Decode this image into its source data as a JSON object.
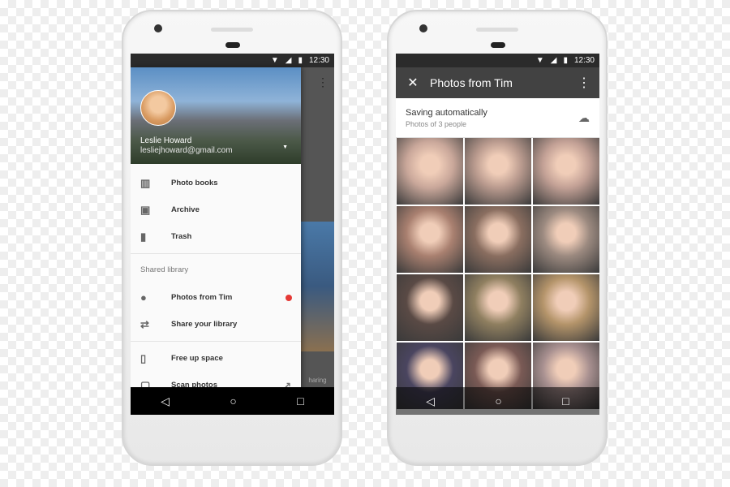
{
  "status": {
    "time": "12:30"
  },
  "left": {
    "account": {
      "name": "Leslie Howard",
      "email": "lesliejhoward@gmail.com"
    },
    "items": [
      {
        "label": "Photo books",
        "icon": "photo-book-icon"
      },
      {
        "label": "Archive",
        "icon": "archive-icon"
      },
      {
        "label": "Trash",
        "icon": "trash-icon"
      }
    ],
    "section": "Shared library",
    "shared": [
      {
        "label": "Photos from Tim",
        "icon": "person-icon"
      },
      {
        "label": "Share your library",
        "icon": "share-icon"
      }
    ],
    "bottom": [
      {
        "label": "Free up space",
        "icon": "phone-check-icon"
      },
      {
        "label": "Scan photos",
        "icon": "scan-icon"
      }
    ],
    "behind_label": "haring"
  },
  "right": {
    "title": "Photos from Tim",
    "banner_title": "Saving automatically",
    "banner_sub": "Photos of 3 people",
    "photo_colors": [
      "#c9a79a",
      "#b99a8e",
      "#c2a095",
      "#a98070",
      "#8a6e60",
      "#9c8a80",
      "#5a4a45",
      "#8f7f60",
      "#b4946a",
      "#4a4560",
      "#7a5a55",
      "#a89090"
    ]
  },
  "colors": {
    "toolbar": "#424242",
    "notify": "#e53935"
  }
}
